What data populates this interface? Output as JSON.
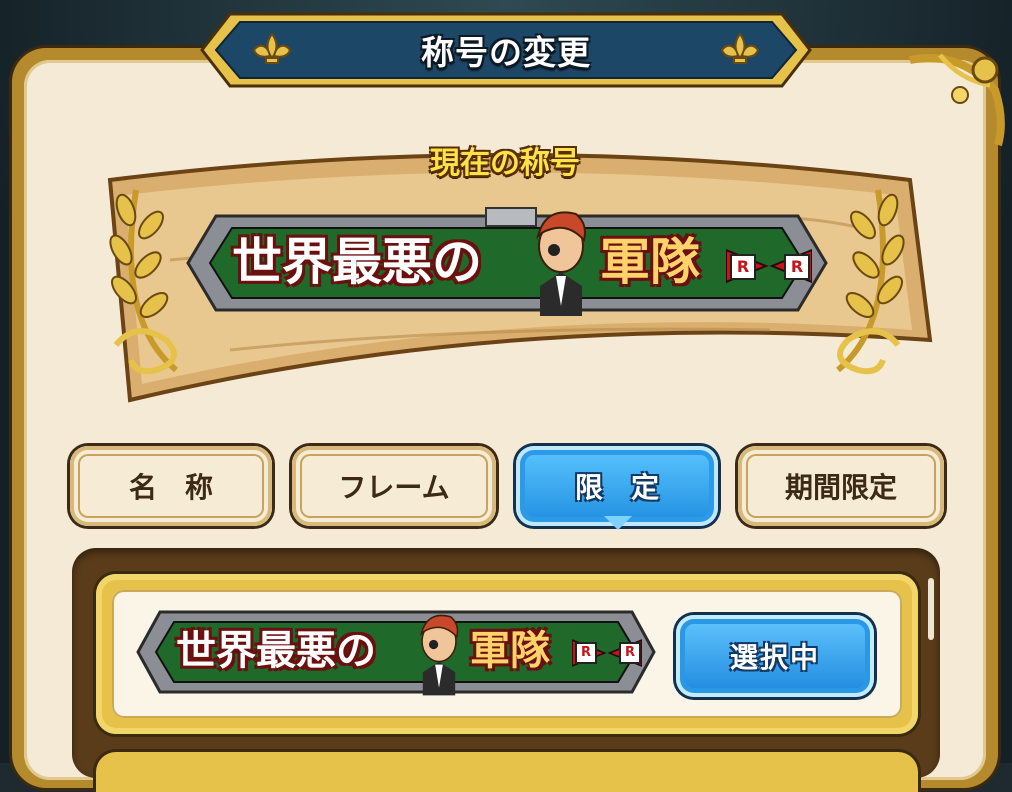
{
  "header": {
    "title": "称号の変更"
  },
  "current": {
    "label": "現在の称号",
    "title_part1": "世界最悪の",
    "title_part2": "軍隊",
    "emblem_letters": [
      "R",
      "R"
    ]
  },
  "tabs": [
    {
      "label": "名　称",
      "active": false
    },
    {
      "label": "フレーム",
      "active": false
    },
    {
      "label": "限　定",
      "active": true
    },
    {
      "label": "期間限定",
      "active": false
    }
  ],
  "list": {
    "items": [
      {
        "title_part1": "世界最悪の",
        "title_part2": "軍隊",
        "emblem_letters": [
          "R",
          "R"
        ],
        "button_label": "選択中"
      }
    ]
  },
  "colors": {
    "accent_blue": "#1f8de0",
    "gold_frame": "#e7c24a",
    "parchment": "#f4ead6",
    "badge_red": "#b3161a"
  }
}
